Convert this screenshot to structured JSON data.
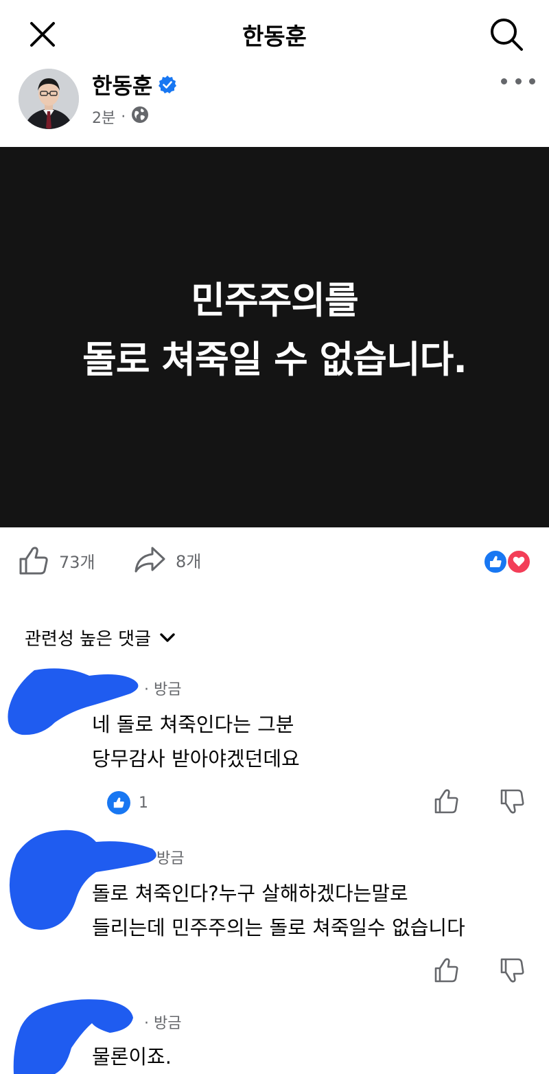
{
  "topbar": {
    "title": "한동훈",
    "close_icon": "close-icon",
    "search_icon": "search-icon"
  },
  "post": {
    "author": "한동훈",
    "time": "2분",
    "dot": "·",
    "visibility_icon": "globe-icon",
    "image_text": {
      "line1": "민주주의를",
      "line2": "돌로 쳐죽일 수 없습니다."
    },
    "likes": "73개",
    "shares": "8개"
  },
  "comments_section": {
    "sort_label": "관련성 높은 댓글"
  },
  "comments": [
    {
      "time": "· 방금",
      "lines": [
        "네 돌로 쳐죽인다는 그분",
        "당무감사 받아야겠던데요"
      ],
      "reaction_count": "1"
    },
    {
      "time": "방금",
      "lines": [
        "돌로 쳐죽인다?누구 살해하겠다는말로",
        "들리는데 민주주의는 돌로 쳐죽일수 없습니다"
      ]
    },
    {
      "time": "· 방금",
      "lines": [
        "물론이죠."
      ]
    }
  ],
  "colors": {
    "accent": "#1877f2",
    "love": "#f33e58",
    "image_bg": "#141414",
    "muted": "#65676b",
    "redaction": "#1f5cf0"
  }
}
